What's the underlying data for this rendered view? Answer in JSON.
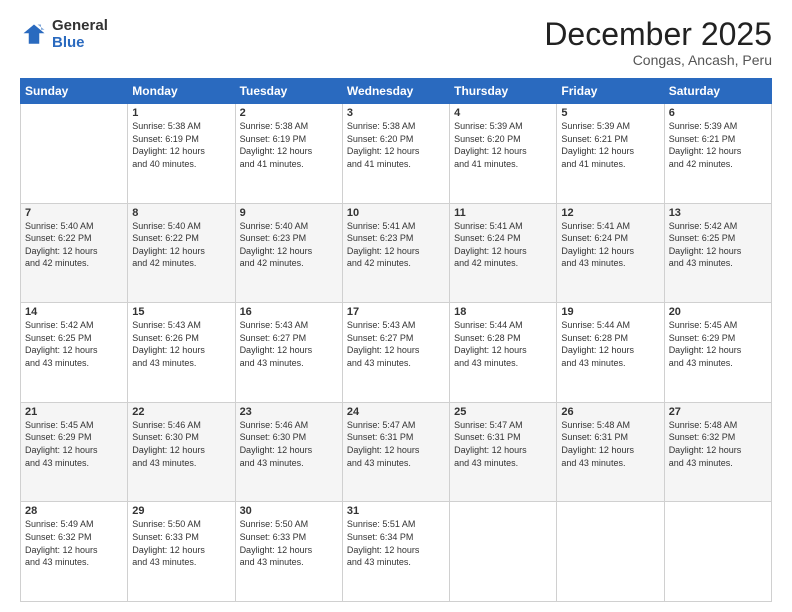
{
  "header": {
    "logo_general": "General",
    "logo_blue": "Blue",
    "title": "December 2025",
    "location": "Congas, Ancash, Peru"
  },
  "days_of_week": [
    "Sunday",
    "Monday",
    "Tuesday",
    "Wednesday",
    "Thursday",
    "Friday",
    "Saturday"
  ],
  "weeks": [
    [
      {
        "day": "",
        "info": ""
      },
      {
        "day": "1",
        "info": "Sunrise: 5:38 AM\nSunset: 6:19 PM\nDaylight: 12 hours\nand 40 minutes."
      },
      {
        "day": "2",
        "info": "Sunrise: 5:38 AM\nSunset: 6:19 PM\nDaylight: 12 hours\nand 41 minutes."
      },
      {
        "day": "3",
        "info": "Sunrise: 5:38 AM\nSunset: 6:20 PM\nDaylight: 12 hours\nand 41 minutes."
      },
      {
        "day": "4",
        "info": "Sunrise: 5:39 AM\nSunset: 6:20 PM\nDaylight: 12 hours\nand 41 minutes."
      },
      {
        "day": "5",
        "info": "Sunrise: 5:39 AM\nSunset: 6:21 PM\nDaylight: 12 hours\nand 41 minutes."
      },
      {
        "day": "6",
        "info": "Sunrise: 5:39 AM\nSunset: 6:21 PM\nDaylight: 12 hours\nand 42 minutes."
      }
    ],
    [
      {
        "day": "7",
        "info": "Sunrise: 5:40 AM\nSunset: 6:22 PM\nDaylight: 12 hours\nand 42 minutes."
      },
      {
        "day": "8",
        "info": "Sunrise: 5:40 AM\nSunset: 6:22 PM\nDaylight: 12 hours\nand 42 minutes."
      },
      {
        "day": "9",
        "info": "Sunrise: 5:40 AM\nSunset: 6:23 PM\nDaylight: 12 hours\nand 42 minutes."
      },
      {
        "day": "10",
        "info": "Sunrise: 5:41 AM\nSunset: 6:23 PM\nDaylight: 12 hours\nand 42 minutes."
      },
      {
        "day": "11",
        "info": "Sunrise: 5:41 AM\nSunset: 6:24 PM\nDaylight: 12 hours\nand 42 minutes."
      },
      {
        "day": "12",
        "info": "Sunrise: 5:41 AM\nSunset: 6:24 PM\nDaylight: 12 hours\nand 43 minutes."
      },
      {
        "day": "13",
        "info": "Sunrise: 5:42 AM\nSunset: 6:25 PM\nDaylight: 12 hours\nand 43 minutes."
      }
    ],
    [
      {
        "day": "14",
        "info": "Sunrise: 5:42 AM\nSunset: 6:25 PM\nDaylight: 12 hours\nand 43 minutes."
      },
      {
        "day": "15",
        "info": "Sunrise: 5:43 AM\nSunset: 6:26 PM\nDaylight: 12 hours\nand 43 minutes."
      },
      {
        "day": "16",
        "info": "Sunrise: 5:43 AM\nSunset: 6:27 PM\nDaylight: 12 hours\nand 43 minutes."
      },
      {
        "day": "17",
        "info": "Sunrise: 5:43 AM\nSunset: 6:27 PM\nDaylight: 12 hours\nand 43 minutes."
      },
      {
        "day": "18",
        "info": "Sunrise: 5:44 AM\nSunset: 6:28 PM\nDaylight: 12 hours\nand 43 minutes."
      },
      {
        "day": "19",
        "info": "Sunrise: 5:44 AM\nSunset: 6:28 PM\nDaylight: 12 hours\nand 43 minutes."
      },
      {
        "day": "20",
        "info": "Sunrise: 5:45 AM\nSunset: 6:29 PM\nDaylight: 12 hours\nand 43 minutes."
      }
    ],
    [
      {
        "day": "21",
        "info": "Sunrise: 5:45 AM\nSunset: 6:29 PM\nDaylight: 12 hours\nand 43 minutes."
      },
      {
        "day": "22",
        "info": "Sunrise: 5:46 AM\nSunset: 6:30 PM\nDaylight: 12 hours\nand 43 minutes."
      },
      {
        "day": "23",
        "info": "Sunrise: 5:46 AM\nSunset: 6:30 PM\nDaylight: 12 hours\nand 43 minutes."
      },
      {
        "day": "24",
        "info": "Sunrise: 5:47 AM\nSunset: 6:31 PM\nDaylight: 12 hours\nand 43 minutes."
      },
      {
        "day": "25",
        "info": "Sunrise: 5:47 AM\nSunset: 6:31 PM\nDaylight: 12 hours\nand 43 minutes."
      },
      {
        "day": "26",
        "info": "Sunrise: 5:48 AM\nSunset: 6:31 PM\nDaylight: 12 hours\nand 43 minutes."
      },
      {
        "day": "27",
        "info": "Sunrise: 5:48 AM\nSunset: 6:32 PM\nDaylight: 12 hours\nand 43 minutes."
      }
    ],
    [
      {
        "day": "28",
        "info": "Sunrise: 5:49 AM\nSunset: 6:32 PM\nDaylight: 12 hours\nand 43 minutes."
      },
      {
        "day": "29",
        "info": "Sunrise: 5:50 AM\nSunset: 6:33 PM\nDaylight: 12 hours\nand 43 minutes."
      },
      {
        "day": "30",
        "info": "Sunrise: 5:50 AM\nSunset: 6:33 PM\nDaylight: 12 hours\nand 43 minutes."
      },
      {
        "day": "31",
        "info": "Sunrise: 5:51 AM\nSunset: 6:34 PM\nDaylight: 12 hours\nand 43 minutes."
      },
      {
        "day": "",
        "info": ""
      },
      {
        "day": "",
        "info": ""
      },
      {
        "day": "",
        "info": ""
      }
    ]
  ]
}
